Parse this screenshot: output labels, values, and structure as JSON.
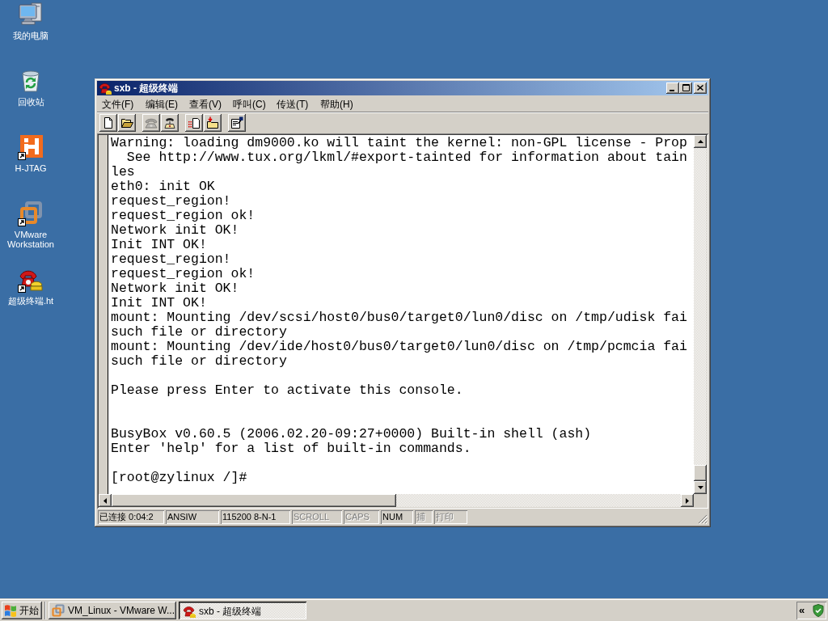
{
  "desktop": {
    "icons": [
      {
        "kind": "computer",
        "label": "我的电脑",
        "shortcut": false
      },
      {
        "kind": "bin",
        "label": "回收站",
        "shortcut": false
      },
      {
        "kind": "h-logo",
        "label": "H-JTAG",
        "shortcut": true
      },
      {
        "kind": "vm",
        "label": "VMware Workstation",
        "shortcut": true
      },
      {
        "kind": "phone",
        "label": "超级终端.ht",
        "shortcut": true
      }
    ]
  },
  "window": {
    "title": "sxb - 超级终端",
    "active": true,
    "menu": [
      "文件(F)",
      "编辑(E)",
      "查看(V)",
      "呼叫(C)",
      "传送(T)",
      "帮助(H)"
    ],
    "toolbar": [
      [
        {
          "kind": "new",
          "disabled": false
        },
        {
          "kind": "open",
          "disabled": false
        }
      ],
      [
        {
          "kind": "call",
          "disabled": true
        },
        {
          "kind": "hangup",
          "disabled": false
        }
      ],
      [
        {
          "kind": "send",
          "disabled": false
        },
        {
          "kind": "receive",
          "disabled": false
        }
      ],
      [
        {
          "kind": "properties",
          "disabled": false
        }
      ]
    ],
    "terminal": {
      "lines": [
        {
          "kind": "text",
          "text": "Warning: loading dm9000.ko will taint the kernel: non-GPL license - Prop"
        },
        {
          "kind": "text",
          "text": "  See http://www.tux.org/lkml/#export-tainted for information about tain"
        },
        {
          "kind": "text",
          "text": "les"
        },
        {
          "kind": "text",
          "text": "eth0: init OK"
        },
        {
          "kind": "text",
          "text": "request_region!"
        },
        {
          "kind": "text",
          "text": "request_region ok!"
        },
        {
          "kind": "text",
          "text": "Network init OK!"
        },
        {
          "kind": "text",
          "text": "Init INT OK!"
        },
        {
          "kind": "text",
          "text": "request_region!"
        },
        {
          "kind": "text",
          "text": "request_region ok!"
        },
        {
          "kind": "text",
          "text": "Network init OK!"
        },
        {
          "kind": "text",
          "text": "Init INT OK!"
        },
        {
          "kind": "text",
          "text": "mount: Mounting /dev/scsi/host0/bus0/target0/lun0/disc on /tmp/udisk fai"
        },
        {
          "kind": "text",
          "text": "such file or directory"
        },
        {
          "kind": "text",
          "text": "mount: Mounting /dev/ide/host0/bus0/target0/lun0/disc on /tmp/pcmcia fai"
        },
        {
          "kind": "text",
          "text": "such file or directory"
        },
        {
          "kind": "blank"
        },
        {
          "kind": "text",
          "text": "Please press Enter to activate this console."
        },
        {
          "kind": "blank"
        },
        {
          "kind": "blank"
        },
        {
          "kind": "text",
          "text": "BusyBox v0.60.5 (2006.02.20-09:27+0000) Built-in shell (ash)"
        },
        {
          "kind": "text",
          "text": "Enter 'help' for a list of built-in commands."
        },
        {
          "kind": "blank"
        },
        {
          "kind": "text",
          "text": "[root@zylinux /]#"
        }
      ]
    },
    "status_bar": [
      {
        "text": "已连接 0:04:2",
        "active": true
      },
      {
        "text": "ANSIW",
        "active": true
      },
      {
        "text": "115200 8-N-1",
        "active": true
      },
      {
        "text": "SCROLL",
        "active": false
      },
      {
        "text": "CAPS",
        "active": false
      },
      {
        "text": "NUM",
        "active": true
      },
      {
        "text": "捕",
        "active": false
      },
      {
        "text": "打印",
        "active": false
      }
    ]
  },
  "taskbar": {
    "start": "开始",
    "tasks": [
      {
        "kind": "vm",
        "label": "VM_Linux - VMware W...",
        "selected": false
      },
      {
        "kind": "phone",
        "label": "sxb - 超级终端",
        "selected": true
      }
    ],
    "tray": {
      "chevron": "«"
    }
  }
}
